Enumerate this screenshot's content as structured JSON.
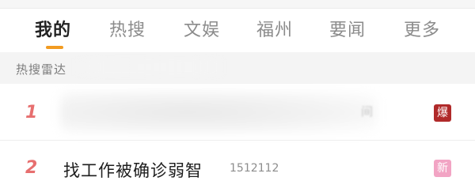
{
  "tabs": [
    {
      "label": "我的",
      "active": true
    },
    {
      "label": "热搜",
      "active": false
    },
    {
      "label": "文娱",
      "active": false
    },
    {
      "label": "福州",
      "active": false
    },
    {
      "label": "要闻",
      "active": false
    },
    {
      "label": "更多",
      "active": false
    }
  ],
  "hint": {
    "text": "热搜雷达"
  },
  "colors": {
    "accent": "#f29b21",
    "rank": "#e76f6f",
    "badge_hot": "#b02a2a",
    "badge_new": "#f2a4c4"
  },
  "list": [
    {
      "rank": "1",
      "title": "",
      "count": "",
      "badge": "爆",
      "tail": "间"
    },
    {
      "rank": "2",
      "title": "找工作被确诊弱智",
      "count": "1512112",
      "badge": "新"
    }
  ]
}
